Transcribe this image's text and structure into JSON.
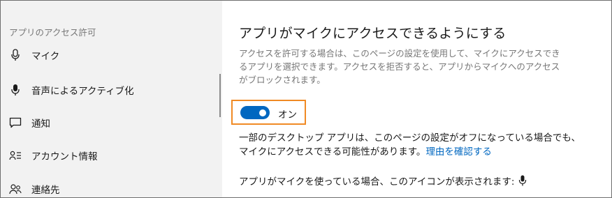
{
  "sidebar": {
    "heading": "アプリのアクセス許可",
    "items": [
      {
        "label": "マイク",
        "icon": "microphone-icon"
      },
      {
        "label": "音声によるアクティブ化",
        "icon": "microphone-filled-icon"
      },
      {
        "label": "通知",
        "icon": "notification-icon"
      },
      {
        "label": "アカウント情報",
        "icon": "account-info-icon"
      },
      {
        "label": "連絡先",
        "icon": "contacts-icon"
      }
    ]
  },
  "main": {
    "title": "アプリがマイクにアクセスできるようにする",
    "description": "アクセスを許可する場合は、このページの設定を使用して、マイクにアクセスできるアプリを選択できます。アクセスを拒否すると、アプリからマイクへのアクセスがブロックされます。",
    "toggle": {
      "state": "on",
      "label": "オン"
    },
    "note_text": "一部のデスクトップ アプリは、このページの設定がオフになっている場合でも、マイクにアクセスできる可能性があります。",
    "note_link": "理由を確認する",
    "footer_text": "アプリがマイクを使っている場合、このアイコンが表示されます:"
  },
  "colors": {
    "accent": "#0067c0",
    "highlight_border": "#f08a24",
    "sidebar_bg": "#f2f2f2",
    "muted_text": "#767676"
  }
}
